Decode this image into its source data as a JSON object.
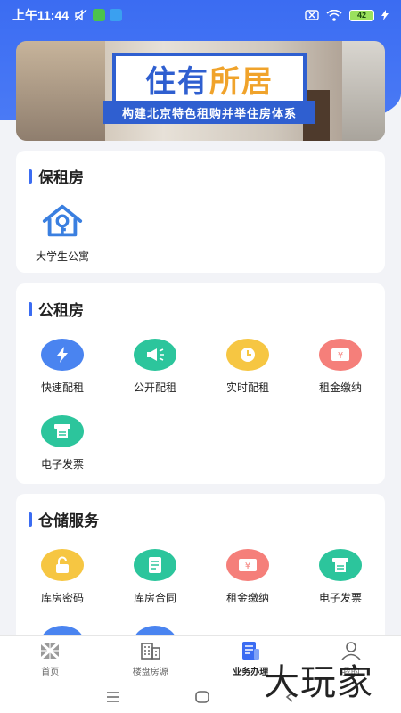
{
  "status_bar": {
    "time": "上午11:44",
    "battery": "42"
  },
  "banner": {
    "title_blue": "住有",
    "title_orange": "所居",
    "subtitle": "构建北京特色租购并举住房体系"
  },
  "sections": {
    "bzf": {
      "title": "保租房",
      "items": [
        {
          "label": "大学生公寓",
          "icon": "house-key-icon"
        }
      ]
    },
    "gzf": {
      "title": "公租房",
      "items": [
        {
          "label": "快速配租",
          "icon": "lightning-icon",
          "color": "#4a84f0"
        },
        {
          "label": "公开配租",
          "icon": "megaphone-icon",
          "color": "#2cc59c"
        },
        {
          "label": "实时配租",
          "icon": "clock-icon",
          "color": "#f6c642"
        },
        {
          "label": "租金缴纳",
          "icon": "payment-icon",
          "color": "#f57f7a"
        },
        {
          "label": "电子发票",
          "icon": "invoice-icon",
          "color": "#2cc59c"
        }
      ]
    },
    "ccfw": {
      "title": "仓储服务",
      "items": [
        {
          "label": "库房密码",
          "icon": "lock-icon",
          "color": "#f6c642"
        },
        {
          "label": "库房合同",
          "icon": "contract-icon",
          "color": "#2cc59c"
        },
        {
          "label": "租金缴纳",
          "icon": "payment-icon",
          "color": "#f57f7a"
        },
        {
          "label": "电子发票",
          "icon": "invoice-icon",
          "color": "#2cc59c"
        }
      ]
    }
  },
  "bottom_nav": {
    "home": "首页",
    "listings": "楼盘房源",
    "business": "业务办理",
    "mine": "我的"
  },
  "watermark": "大玩家"
}
